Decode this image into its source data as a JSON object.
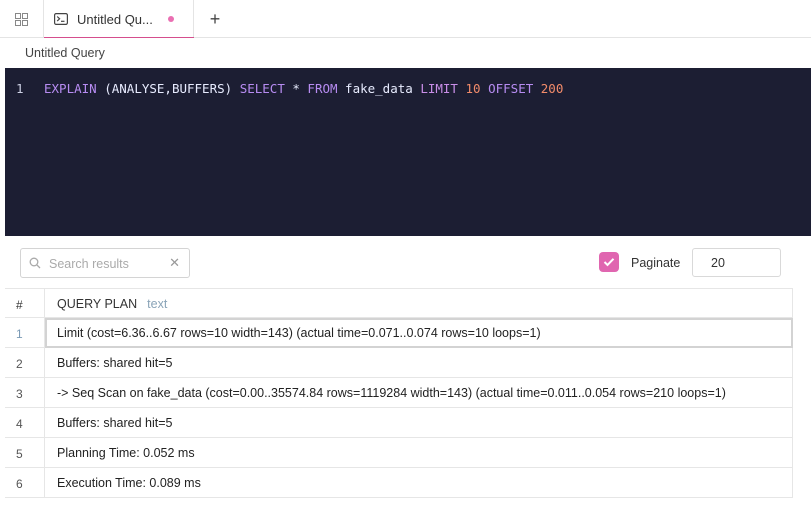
{
  "tabs": [
    {
      "label": "Untitled Qu...",
      "modified": true
    }
  ],
  "breadcrumb": "Untitled Query",
  "editor": {
    "line_number": "1",
    "tokens": [
      {
        "text": "EXPLAIN",
        "kind": "kw"
      },
      {
        "text": " ",
        "kind": "plain"
      },
      {
        "text": "(ANALYSE,BUFFERS)",
        "kind": "plain"
      },
      {
        "text": " ",
        "kind": "plain"
      },
      {
        "text": "SELECT",
        "kind": "kw"
      },
      {
        "text": " * ",
        "kind": "plain"
      },
      {
        "text": "FROM",
        "kind": "kw"
      },
      {
        "text": " fake_data ",
        "kind": "plain"
      },
      {
        "text": "LIMIT",
        "kind": "lim"
      },
      {
        "text": " ",
        "kind": "plain"
      },
      {
        "text": "10",
        "kind": "num"
      },
      {
        "text": " ",
        "kind": "plain"
      },
      {
        "text": "OFFSET",
        "kind": "kw"
      },
      {
        "text": " ",
        "kind": "plain"
      },
      {
        "text": "200",
        "kind": "num"
      }
    ]
  },
  "toolbar": {
    "search_placeholder": "Search results",
    "paginate_label": "Paginate",
    "paginate_checked": true,
    "page_size": "20"
  },
  "table": {
    "index_header": "#",
    "column_header": "QUERY PLAN",
    "column_type": "text",
    "rows": [
      {
        "index": "1",
        "value": "Limit (cost=6.36..6.67 rows=10 width=143) (actual time=0.071..0.074 rows=10 loops=1)"
      },
      {
        "index": "2",
        "value": "Buffers: shared hit=5"
      },
      {
        "index": "3",
        "value": "-> Seq Scan on fake_data (cost=0.00..35574.84 rows=1119284 width=143) (actual time=0.011..0.054 rows=210 loops=1)"
      },
      {
        "index": "4",
        "value": "Buffers: shared hit=5"
      },
      {
        "index": "5",
        "value": "Planning Time: 0.052 ms"
      },
      {
        "index": "6",
        "value": "Execution Time: 0.089 ms"
      }
    ]
  },
  "colors": {
    "accent": "#d54e8d",
    "editor_bg": "#1c1e33",
    "checkbox": "#e066b0"
  },
  "icons": {
    "grid": "grid-icon",
    "terminal": "terminal-icon",
    "add_tab": "plus-icon",
    "search": "search-icon",
    "clear": "close-icon",
    "check": "check-icon"
  }
}
